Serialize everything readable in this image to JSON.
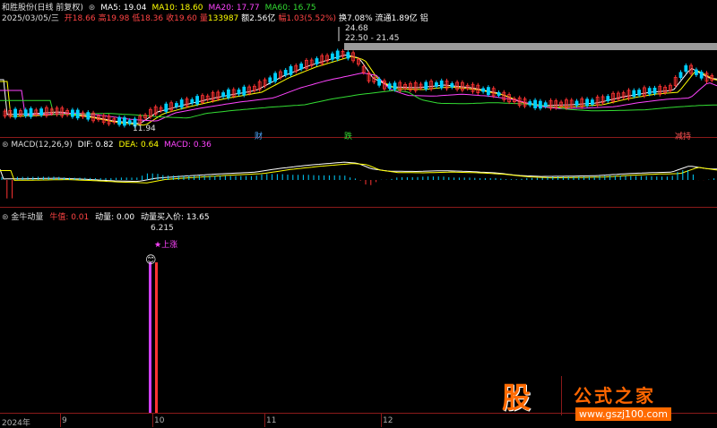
{
  "header": {
    "stock_title": "和胜股份(日线 前复权)",
    "date": "2025/03/05/三",
    "ma": [
      {
        "label": "MA5: 19.04",
        "color": "#ffffff"
      },
      {
        "label": "MA10: 18.60",
        "color": "#ffff00"
      },
      {
        "label": "MA20: 17.77",
        "color": "#ff44ff"
      },
      {
        "label": "MA60: 16.75",
        "color": "#33dd33"
      }
    ],
    "ohlc": [
      {
        "label": "开",
        "value": "18.66",
        "lc": "#ff4444",
        "vc": "#ff4444"
      },
      {
        "label": "高",
        "value": "19.98",
        "lc": "#ff4444",
        "vc": "#ff4444"
      },
      {
        "label": "低",
        "value": "18.36",
        "lc": "#ff4444",
        "vc": "#ff4444"
      },
      {
        "label": "收",
        "value": "19.60",
        "lc": "#ff4444",
        "vc": "#ff4444"
      },
      {
        "label": "量",
        "value": "133987",
        "lc": "#ff4444",
        "vc": "#ffff00"
      },
      {
        "label": "额",
        "value": "2.56亿",
        "lc": "#ffffff",
        "vc": "#ffffff"
      },
      {
        "label": "幅",
        "value": "1.03(5.52%)",
        "lc": "#ff4444",
        "vc": "#ff4444"
      },
      {
        "label": "换",
        "value": "7.08%",
        "lc": "#ffffff",
        "vc": "#ffffff"
      },
      {
        "label": "流通",
        "value": "1.89亿",
        "lc": "#ffffff",
        "vc": "#ffffff"
      },
      {
        "label": "铝",
        "value": "",
        "lc": "#ffffff",
        "vc": "#ffffff"
      }
    ]
  },
  "price_annotations": {
    "high": "24.68",
    "range": "22.50 - 21.45",
    "low": "11.94",
    "events": [
      "财",
      "跌",
      "减持"
    ]
  },
  "macd": {
    "title": "MACD(12,26,9)",
    "dif_label": "DIF: 0.82",
    "dea_label": "DEA: 0.64",
    "macd_label": "MACD: 0.36"
  },
  "indicator": {
    "title": "金牛动量",
    "niuzhi": "牛值: 0.01",
    "dongliang": "动量: 0.00",
    "buy_price": "动量买入价: 13.65",
    "peak": "6.215",
    "signal": "★上涨"
  },
  "xaxis": [
    "2024年",
    "9",
    "10",
    "11",
    "12"
  ],
  "watermark": {
    "logo": "股",
    "site": "公式之家",
    "url": "www.gszj100.com"
  },
  "colors": {
    "up": "#ff3333",
    "down": "#00d0ff",
    "bg": "#000000",
    "sep": "#8b1a1a"
  }
}
